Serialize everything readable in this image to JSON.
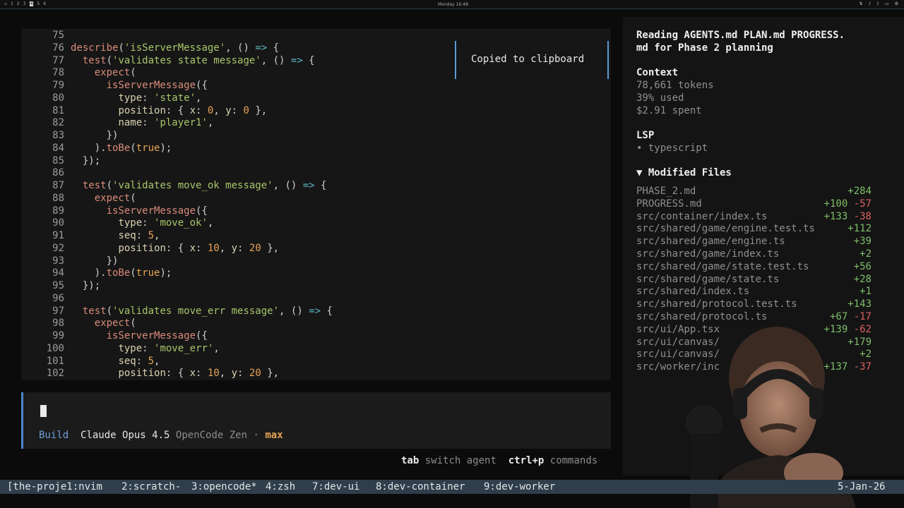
{
  "topbar": {
    "workspaces": [
      "1",
      "2",
      "3",
      "4",
      "5",
      "6"
    ],
    "clock": "Monday 16:48",
    "tray_icons": [
      "network-icon",
      "audio-icon",
      "bluetooth-icon",
      "battery-icon",
      "settings-icon"
    ]
  },
  "editor": {
    "lines": [
      {
        "n": "75",
        "code": ""
      },
      {
        "n": "76",
        "code": "describe('isServerMessage', () => {"
      },
      {
        "n": "77",
        "code": "  test('validates state message', () => {"
      },
      {
        "n": "78",
        "code": "    expect("
      },
      {
        "n": "79",
        "code": "      isServerMessage({"
      },
      {
        "n": "80",
        "code": "        type: 'state',"
      },
      {
        "n": "81",
        "code": "        position: { x: 0, y: 0 },"
      },
      {
        "n": "82",
        "code": "        name: 'player1',"
      },
      {
        "n": "83",
        "code": "      })"
      },
      {
        "n": "84",
        "code": "    ).toBe(true);"
      },
      {
        "n": "85",
        "code": "  });"
      },
      {
        "n": "86",
        "code": ""
      },
      {
        "n": "87",
        "code": "  test('validates move_ok message', () => {"
      },
      {
        "n": "88",
        "code": "    expect("
      },
      {
        "n": "89",
        "code": "      isServerMessage({"
      },
      {
        "n": "90",
        "code": "        type: 'move_ok',"
      },
      {
        "n": "91",
        "code": "        seq: 5,"
      },
      {
        "n": "92",
        "code": "        position: { x: 10, y: 20 },"
      },
      {
        "n": "93",
        "code": "      })"
      },
      {
        "n": "94",
        "code": "    ).toBe(true);"
      },
      {
        "n": "95",
        "code": "  });"
      },
      {
        "n": "96",
        "code": ""
      },
      {
        "n": "97",
        "code": "  test('validates move_err message', () => {"
      },
      {
        "n": "98",
        "code": "    expect("
      },
      {
        "n": "99",
        "code": "      isServerMessage({"
      },
      {
        "n": "100",
        "code": "        type: 'move_err',"
      },
      {
        "n": "101",
        "code": "        seq: 5,"
      },
      {
        "n": "102",
        "code": "        position: { x: 10, y: 20 },"
      }
    ],
    "toast": "Copied to clipboard"
  },
  "prompt": {
    "agent": "Build",
    "model": "Claude Opus 4.5",
    "provider": "OpenCode Zen",
    "separator": "·",
    "variant": "max"
  },
  "hints": {
    "tab_key": "tab",
    "tab_action": "switch agent",
    "cmd_key": "ctrl+p",
    "cmd_action": "commands"
  },
  "sidebar": {
    "title": "Reading AGENTS.md PLAN.md PROGRESS.\nmd for Phase 2 planning",
    "context_heading": "Context",
    "tokens": "78,661 tokens",
    "used": "39% used",
    "spent": "$2.91 spent",
    "lsp_heading": "LSP",
    "lsp_item": "• typescript",
    "files_heading": "▼ Modified Files",
    "files": [
      {
        "name": "PHASE_2.md",
        "add": "+284",
        "del": ""
      },
      {
        "name": "PROGRESS.md",
        "add": "+100",
        "del": "-57"
      },
      {
        "name": "src/container/index.ts",
        "add": "+133",
        "del": "-38"
      },
      {
        "name": "src/shared/game/engine.test.ts",
        "add": "+112",
        "del": ""
      },
      {
        "name": "src/shared/game/engine.ts",
        "add": "+39",
        "del": ""
      },
      {
        "name": "src/shared/game/index.ts",
        "add": "+2",
        "del": ""
      },
      {
        "name": "src/shared/game/state.test.ts",
        "add": "+56",
        "del": ""
      },
      {
        "name": "src/shared/game/state.ts",
        "add": "+28",
        "del": ""
      },
      {
        "name": "src/shared/index.ts",
        "add": "+1",
        "del": ""
      },
      {
        "name": "src/shared/protocol.test.ts",
        "add": "+143",
        "del": ""
      },
      {
        "name": "src/shared/protocol.ts",
        "add": "+67",
        "del": "-17"
      },
      {
        "name": "src/ui/App.tsx",
        "add": "+139",
        "del": "-62"
      },
      {
        "name": "src/ui/canvas/",
        "add": "+179",
        "del": ""
      },
      {
        "name": "src/ui/canvas/",
        "add": "+2",
        "del": ""
      },
      {
        "name": "src/worker/inc",
        "add": "+137",
        "del": "-37"
      }
    ]
  },
  "tmux": {
    "windows": [
      "[the-proje1:nvim",
      "2:scratch-",
      "3:opencode*",
      "4:zsh",
      "7:dev-ui",
      "8:dev-container",
      "9:dev-worker"
    ],
    "date": "5-Jan-26"
  }
}
